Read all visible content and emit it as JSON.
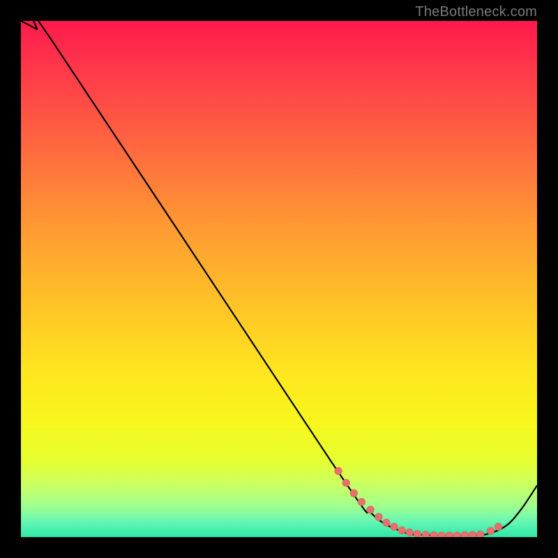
{
  "watermark": "TheBottleneck.com",
  "colors": {
    "curve": "#000000",
    "dot": "#e7706e",
    "dot_stroke": "#d85a58"
  },
  "chart_data": {
    "type": "line",
    "title": "",
    "xlabel": "",
    "ylabel": "",
    "xlim": [
      0,
      100
    ],
    "ylim": [
      0,
      100
    ],
    "grid": false,
    "legend": false,
    "series": [
      {
        "name": "bottleneck-curve",
        "x": [
          0,
          3,
          6,
          60,
          68,
          74,
          78,
          82,
          86,
          90,
          94,
          97,
          100
        ],
        "y": [
          100,
          98.4,
          96.2,
          14.8,
          4.5,
          1.0,
          0.4,
          0.3,
          0.3,
          0.5,
          2.2,
          5.5,
          10.0
        ]
      }
    ],
    "scatter_points": {
      "x": [
        61.5,
        63.0,
        64.5,
        66.0,
        67.7,
        69.3,
        70.8,
        72.3,
        73.8,
        75.3,
        76.8,
        78.4,
        80.0,
        81.5,
        83.0,
        84.5,
        86.0,
        87.5,
        89.0,
        91.0,
        92.5
      ],
      "y": [
        12.8,
        10.5,
        8.5,
        6.8,
        5.3,
        3.9,
        2.8,
        2.0,
        1.3,
        0.9,
        0.6,
        0.45,
        0.35,
        0.3,
        0.3,
        0.3,
        0.35,
        0.4,
        0.5,
        1.2,
        2.0
      ]
    }
  }
}
